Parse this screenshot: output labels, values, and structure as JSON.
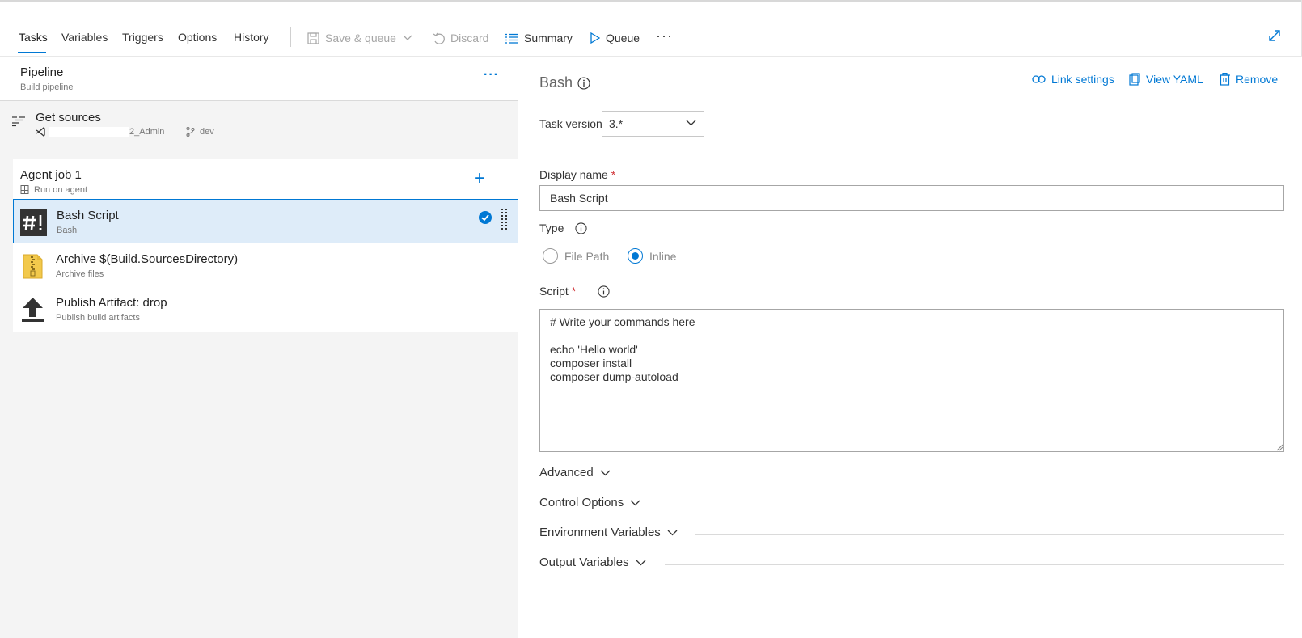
{
  "toolbar": {
    "tabs": [
      "Tasks",
      "Variables",
      "Triggers",
      "Options",
      "History"
    ],
    "save_queue": "Save & queue",
    "discard": "Discard",
    "summary": "Summary",
    "queue": "Queue",
    "more": "···"
  },
  "pipeline": {
    "title": "Pipeline",
    "subtitle": "Build pipeline",
    "more": "···"
  },
  "sources": {
    "title": "Get sources",
    "repo": "2_Admin",
    "branch": "dev"
  },
  "job": {
    "title": "Agent job 1",
    "subtitle": "Run on agent",
    "add": "+"
  },
  "tasks": [
    {
      "title": "Bash Script",
      "subtitle": "Bash"
    },
    {
      "title": "Archive $(Build.SourcesDirectory)",
      "subtitle": "Archive files"
    },
    {
      "title": "Publish Artifact: drop",
      "subtitle": "Publish build artifacts"
    }
  ],
  "detail": {
    "task_name": "Bash",
    "link_settings": "Link settings",
    "view_yaml": "View YAML",
    "remove": "Remove",
    "task_version_label": "Task version",
    "task_version_value": "3.*",
    "display_name_label": "Display name",
    "required_mark": "*",
    "display_name_value": "Bash Script",
    "type_label": "Type",
    "type_options": [
      "File Path",
      "Inline"
    ],
    "type_selected": "Inline",
    "script_label": "Script",
    "script_value": "# Write your commands here\n\necho 'Hello world'\ncomposer install\ncomposer dump-autoload",
    "sections": [
      "Advanced",
      "Control Options",
      "Environment Variables",
      "Output Variables"
    ]
  },
  "colors": {
    "accent": "#0078d4",
    "selected_bg": "#deecf9",
    "required": "#d13438"
  }
}
